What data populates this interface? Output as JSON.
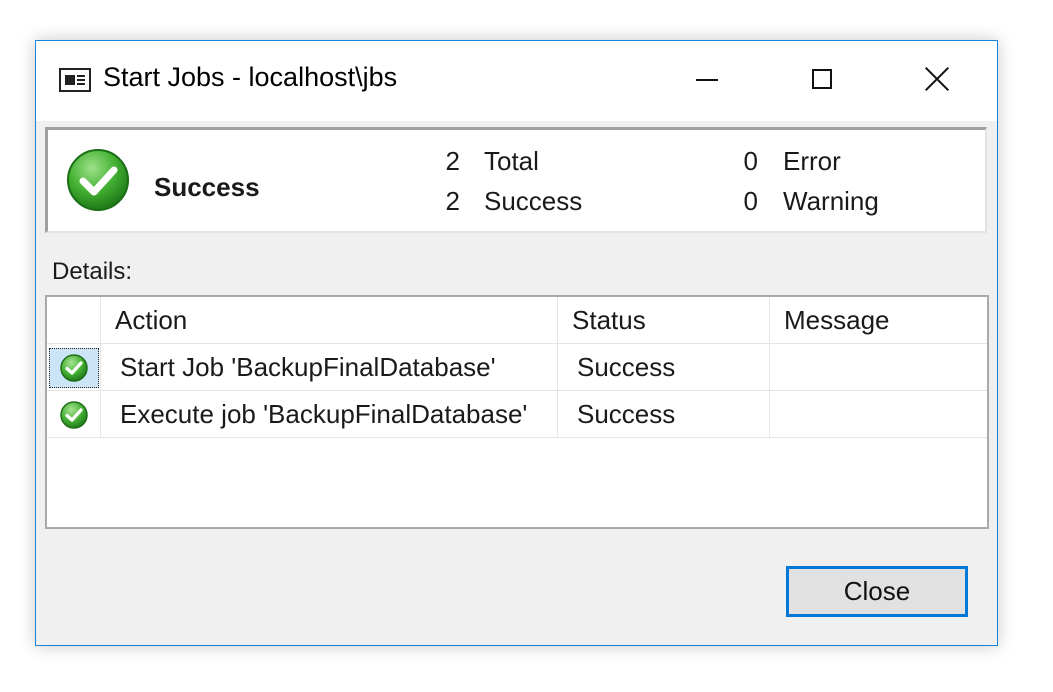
{
  "window": {
    "title": "Start Jobs - localhost\\jbs",
    "icon": "window-app-icon",
    "controls": {
      "minimize": "minimize-icon",
      "maximize": "maximize-icon",
      "close": "close-icon"
    }
  },
  "summary": {
    "icon": "success-check-icon",
    "status": "Success",
    "total_count": "2",
    "total_label": "Total",
    "success_count": "2",
    "success_label": "Success",
    "error_count": "0",
    "error_label": "Error",
    "warning_count": "0",
    "warning_label": "Warning"
  },
  "details": {
    "label": "Details:",
    "columns": [
      "Action",
      "Status",
      "Message"
    ],
    "rows": [
      {
        "icon": "success-check-icon",
        "action": "Start Job 'BackupFinalDatabase'",
        "status": "Success",
        "message": ""
      },
      {
        "icon": "success-check-icon",
        "action": "Execute job 'BackupFinalDatabase'",
        "status": "Success",
        "message": ""
      }
    ]
  },
  "buttons": {
    "close_label": "Close"
  },
  "colors": {
    "accent": "#0078d7",
    "success_green": "#3aa832"
  }
}
